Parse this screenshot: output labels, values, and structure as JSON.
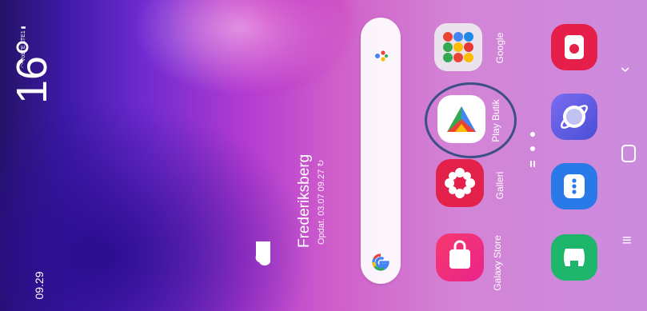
{
  "status_bar": {
    "time": "09.29",
    "signal_text": "VoLTE LTE1"
  },
  "weather": {
    "temperature": "16°",
    "city": "Frederiksberg",
    "updated": "Opdat. 03.07 09.27"
  },
  "apps": {
    "google_folder": "Google",
    "play_store": "Play Butik",
    "gallery": "Galleri",
    "galaxy_store": "Galaxy Store"
  },
  "icons": [
    "wifi-icon",
    "signal-icon",
    "battery-icon",
    "cloud-icon",
    "refresh-icon",
    "mic-icon",
    "google-g-icon",
    "camera-icon",
    "internet-icon",
    "messages-icon",
    "phone-icon",
    "back-icon",
    "home-icon",
    "recents-icon"
  ],
  "colors": {
    "highlight_ring": "#3c4f86",
    "gallery": "#e3214b",
    "galaxy_store": "#ef2e74",
    "camera": "#e51f4a",
    "internet": "#5b5fe0",
    "messages": "#2979e8",
    "phone": "#1db66b"
  }
}
